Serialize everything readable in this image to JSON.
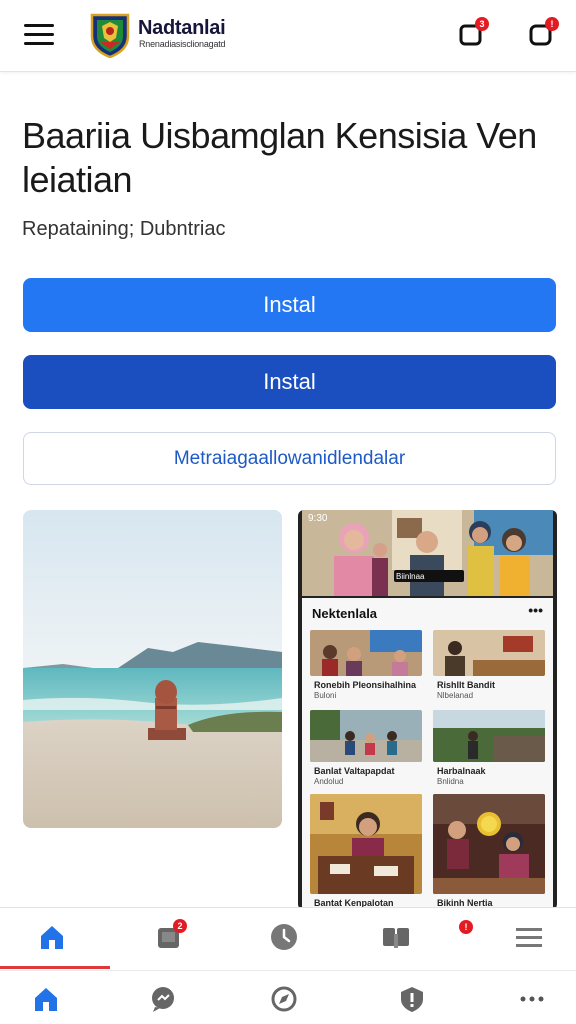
{
  "header": {
    "brand_title": "Nadtanlai",
    "brand_sub": "Rnenadiasisclionagatd",
    "notif_badge_count": "3",
    "alert_badge": "!"
  },
  "page": {
    "title": "Baariia Uisbamglan Kensisia Ven leiatian",
    "subtitle": "Repataining; Dubntriac"
  },
  "actions": {
    "primary_label": "Instal",
    "secondary_label": "Instal",
    "outline_label": "Metraiagaallowanidlendalar"
  },
  "phone_preview": {
    "status_time": "9:30",
    "banner_caption": "Biinlnaa",
    "card_title": "Nektenlala",
    "more": "•••",
    "items": [
      {
        "caption": "Ronebih Pleonsihalhina",
        "sub": "Buloni"
      },
      {
        "caption": "Rishllt Bandit",
        "sub": "Nlbelanad"
      },
      {
        "caption": "Banlat Valtapapdat",
        "sub": "Andolud"
      },
      {
        "caption": "Harbalnaak",
        "sub": "Bnlidna"
      },
      {
        "caption": "Bantat Kenpalotan",
        "sub": ""
      },
      {
        "caption": "Bikinh Nertia",
        "sub": ""
      }
    ]
  },
  "tabbar": {
    "messages_badge": "2",
    "contacts_badge": "!"
  },
  "colors": {
    "primary": "#2477f2",
    "secondary": "#1b4fc0",
    "accent": "#e0383a",
    "active_icon": "#2373e8"
  },
  "icons": {
    "menu": "menu-icon",
    "notifications": "notification-icon",
    "alerts": "alert-icon",
    "tab_home": "home-icon",
    "tab_inbox": "inbox-icon",
    "tab_calls": "clock-icon",
    "tab_contacts": "contacts-icon",
    "tab_menu": "list-icon",
    "nav_home": "home-icon",
    "nav_chat": "chat-icon",
    "nav_compass": "compass-icon",
    "nav_shield": "shield-icon",
    "nav_more": "more-icon"
  }
}
